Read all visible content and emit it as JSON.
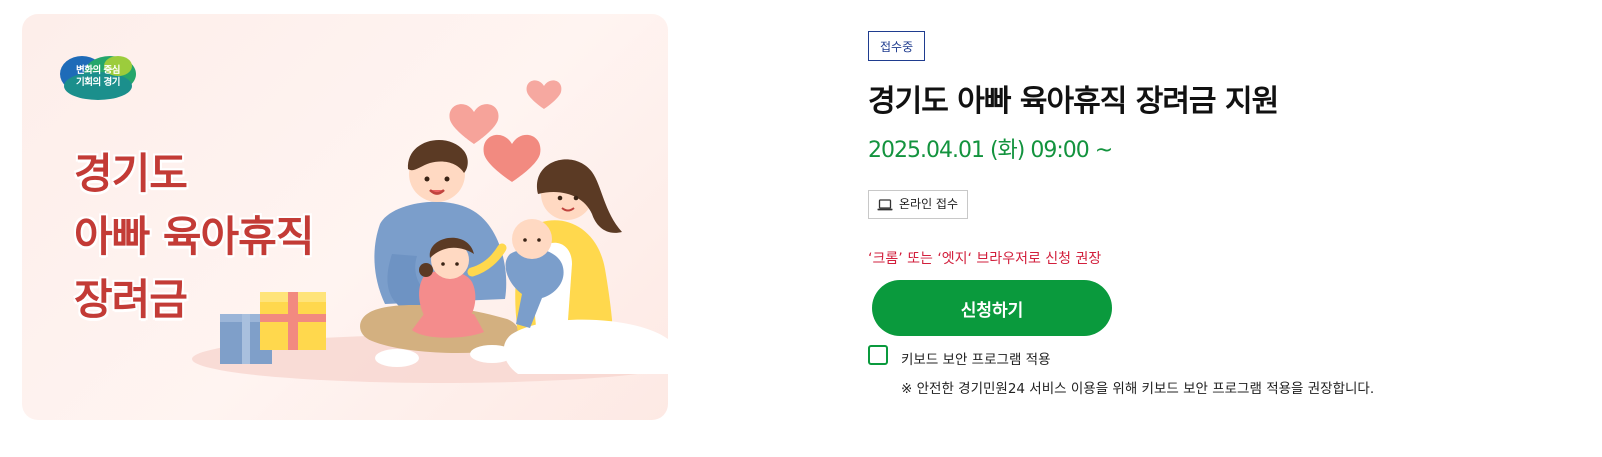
{
  "banner": {
    "logo_text": "변화의 중심\n기회의 경기",
    "title_lines": [
      "경기도",
      "아빠 육아휴직",
      "장려금"
    ]
  },
  "service": {
    "status_badge": "접수중",
    "title": "경기도 아빠 육아휴직 장려금 지원",
    "date": "2025.04.01 (화) 09:00 ~",
    "online_badge": "온라인 접수",
    "browser_note": "‘크롬’ 또는 ‘엣지‘ 브라우저로 신청 권장",
    "apply_label": "신청하기",
    "keyboard_security_label": "키보드 보안 프로그램 적용",
    "security_note": "※ 안전한 경기민원24 서비스 이용을 위해 키보드 보안 프로그램 적용을 권장합니다."
  },
  "colors": {
    "accent_green": "#0a9a3d",
    "date_green": "#13933e",
    "status_blue": "#1f3c8f",
    "note_red": "#d21f3c",
    "banner_title_red": "#c33b36"
  },
  "icons": {
    "online_badge": "laptop-icon",
    "checkbox": "checkbox-unchecked"
  }
}
